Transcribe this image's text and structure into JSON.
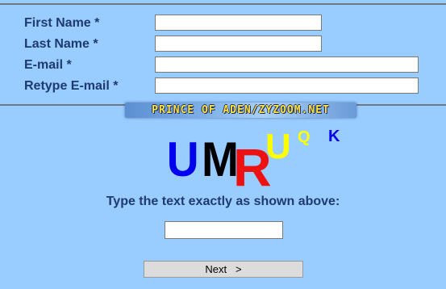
{
  "form": {
    "first_name_label": "First Name *",
    "last_name_label": "Last Name *",
    "email_label": "E-mail *",
    "retype_email_label": "Retype E-mail *",
    "first_name_value": "",
    "last_name_value": "",
    "email_value": "",
    "retype_email_value": ""
  },
  "watermark": {
    "text": "PRINCE OF ADEN/ZYZOOM.NET"
  },
  "captcha": {
    "characters": [
      {
        "char": "U",
        "color": "#0000ee"
      },
      {
        "char": "M",
        "color": "#000000"
      },
      {
        "char": "R",
        "color": "#ee1111"
      },
      {
        "char": "U",
        "color": "#ffff00"
      },
      {
        "char": "Q",
        "color": "#ffff00"
      },
      {
        "char": "K",
        "color": "#0000ee"
      }
    ],
    "prompt": "Type the text exactly as shown above:",
    "answer_value": ""
  },
  "actions": {
    "next_label": "Next   >"
  }
}
